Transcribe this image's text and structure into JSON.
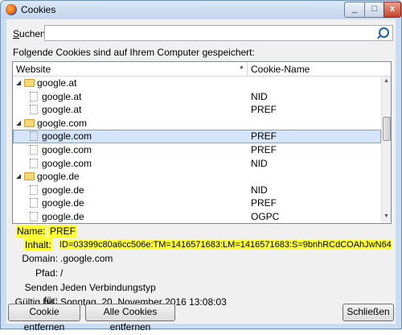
{
  "window": {
    "title": "Cookies",
    "controls": [
      "_",
      "□",
      "x"
    ]
  },
  "search": {
    "label_prefix": "S",
    "label_rest": "uchen",
    "value": ""
  },
  "description": "Folgende Cookies sind auf Ihrem Computer gespeichert:",
  "table": {
    "col_website": "Website",
    "col_cookie_name": "Cookie-Name",
    "rows": [
      {
        "type": "group",
        "website": "google.at",
        "name": ""
      },
      {
        "type": "item",
        "website": "google.at",
        "name": "NID"
      },
      {
        "type": "item",
        "website": "google.at",
        "name": "PREF"
      },
      {
        "type": "group",
        "website": "google.com",
        "name": ""
      },
      {
        "type": "item",
        "website": "google.com",
        "name": "PREF",
        "selected": true
      },
      {
        "type": "item",
        "website": "google.com",
        "name": "PREF"
      },
      {
        "type": "item",
        "website": "google.com",
        "name": "NID"
      },
      {
        "type": "group",
        "website": "google.de",
        "name": ""
      },
      {
        "type": "item",
        "website": "google.de",
        "name": "NID"
      },
      {
        "type": "item",
        "website": "google.de",
        "name": "PREF"
      },
      {
        "type": "item",
        "website": "google.de",
        "name": "OGPC"
      }
    ]
  },
  "details": {
    "name_label": "Name:",
    "name_value": "PREF",
    "content_label": "Inhalt:",
    "content_value": "ID=03399c80a6cc506e:TM=1416571683:LM=1416571683:S=9bnhRCdCOAhJwN64",
    "domain_label": "Domain:",
    "domain_value": ".google.com",
    "path_label": "Pfad:",
    "path_value": "/",
    "send_label": "Senden für:",
    "send_value": "Jeden Verbindungstyp",
    "expires_label": "Gültig bis:",
    "expires_value": "Sonntag, 20. November 2016 13:08:03"
  },
  "buttons": {
    "remove_cookie": "Cookie entfernen",
    "remove_all": "Alle Cookies entfernen",
    "close": "Schließen"
  },
  "colors": {
    "highlight": "#ffff33",
    "selection": "#d6e6fa"
  }
}
